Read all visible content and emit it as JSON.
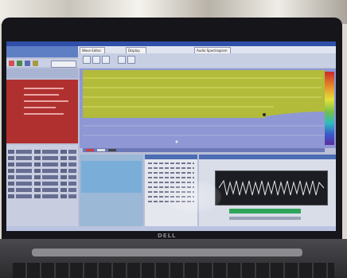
{
  "device": {
    "brand": "DELL"
  },
  "app": {
    "tabs": [
      "Wave Editor",
      "Display",
      "Audio Spectrogram"
    ],
    "left_panel": {
      "header": "Controls",
      "button": "Settings"
    },
    "status": ""
  },
  "colors": {
    "plot_background": "#b2bb3a",
    "plot_lower": "#8f98d4",
    "red_panel": "#b03030",
    "title_bar": "#2f4fa8"
  }
}
